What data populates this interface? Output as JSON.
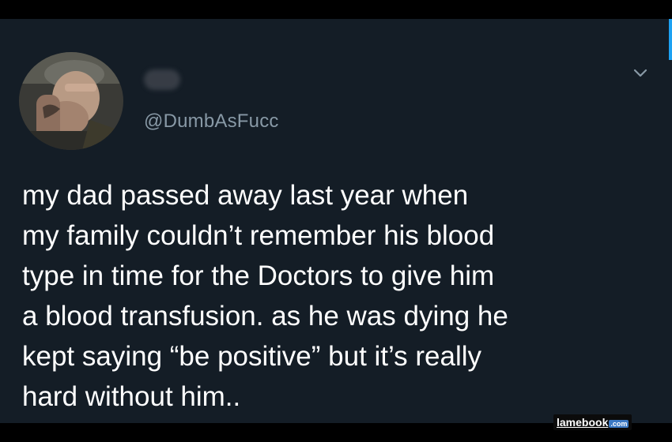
{
  "tweet": {
    "handle": "@DumbAsFucc",
    "text": "my dad passed away last year when\nmy family couldn’t remember his blood\ntype in time for the Doctors to give him\na blood transfusion. as he was dying he\nkept saying “be positive”  but it’s really\nhard without him..",
    "avatar_icon": "user-avatar-photo",
    "menu_icon": "chevron-down-icon",
    "colors": {
      "card_background": "#141d26",
      "handle": "#8899a6",
      "text": "#ffffff",
      "accent": "#1da1f2"
    }
  },
  "watermark": {
    "site": "lamebook",
    "tld": ".com"
  }
}
